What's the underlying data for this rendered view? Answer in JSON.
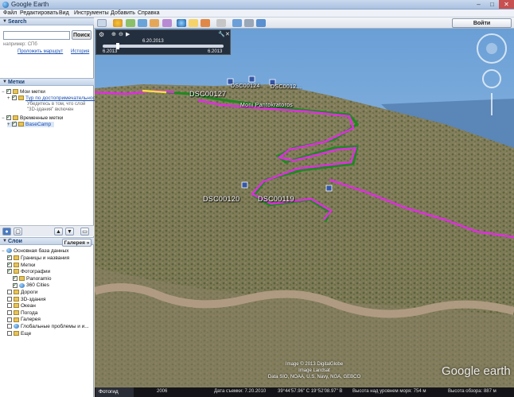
{
  "window": {
    "title": "Google Earth",
    "controls": {
      "minimize": "–",
      "maximize": "□",
      "close": "✕"
    }
  },
  "menu": [
    "Файл",
    "Редактировать",
    "Вид",
    "Инструменты",
    "Добавить",
    "Справка"
  ],
  "search": {
    "header": "Search",
    "input_value": "",
    "button": "Поиск",
    "hint": "например: СПб",
    "route_link": "Проложить маршрут",
    "history_link": "История"
  },
  "places": {
    "header": "Метки",
    "my_places": "Мои метки",
    "sightseeing_link": "Тур по достопримечательнос",
    "sightseeing_note1": "Убедитесь в том, что слой",
    "sightseeing_note2": "\"3D-здания\" включен",
    "temp_places": "Временные метки",
    "basecamp": "BaseCamp"
  },
  "layers": {
    "header": "Слои",
    "gallery_button": "Галерея",
    "primary_db": "Основная база данных",
    "items": [
      {
        "label": "Границы и названия",
        "checked": true,
        "indent": 1
      },
      {
        "label": "Метки",
        "checked": true,
        "indent": 1
      },
      {
        "label": "Фотографии",
        "checked": true,
        "indent": 1
      },
      {
        "label": "Panoramio",
        "checked": true,
        "indent": 2
      },
      {
        "label": "360 Cities",
        "checked": true,
        "indent": 2
      },
      {
        "label": "Дороги",
        "checked": false,
        "indent": 1
      },
      {
        "label": "3D-здания",
        "checked": false,
        "indent": 1
      },
      {
        "label": "Океан",
        "checked": false,
        "indent": 1
      },
      {
        "label": "Погода",
        "checked": false,
        "indent": 1
      },
      {
        "label": "Галерея",
        "checked": false,
        "indent": 1
      },
      {
        "label": "Глобальные проблемы и и...",
        "checked": false,
        "indent": 1
      },
      {
        "label": "Еще",
        "checked": false,
        "indent": 1
      }
    ]
  },
  "toolbar": {
    "signin": "Войти"
  },
  "timeslider": {
    "top_date": "6.20.2013",
    "start_date": "6.2013",
    "end_date": "6.2013"
  },
  "map_labels": {
    "dsc127": "DSC00127",
    "dsc124": "DSC00124",
    "dsc125": "DSC0012...",
    "track_name": "Moni Pantokratoros",
    "dsc120": "DSC00120",
    "dsc119": "DSC00119"
  },
  "credits": {
    "line1": "Image © 2013 DigitalGlobe",
    "line2": "Image Landsat",
    "line3": "Data SIO, NOAA, U.S. Navy, NGA, GEBCO",
    "logo": "Google earth"
  },
  "status": {
    "tour_button": "Фотогид",
    "year": "2006",
    "capture_date": "Дата съемки: 7.20.2010",
    "coords": "39°44'57.96\" С  19°52'08.97\" В",
    "elevation": "Высота над уровнем моря: 754 м",
    "eye_alt": "Высота обзора: 887 м"
  },
  "colors": {
    "track_magenta": "#e02de0",
    "track_green": "#1f8a1f",
    "track_yellow": "#f2e23a",
    "sky": "#7fb2e0",
    "sea": "#5a86b8"
  }
}
